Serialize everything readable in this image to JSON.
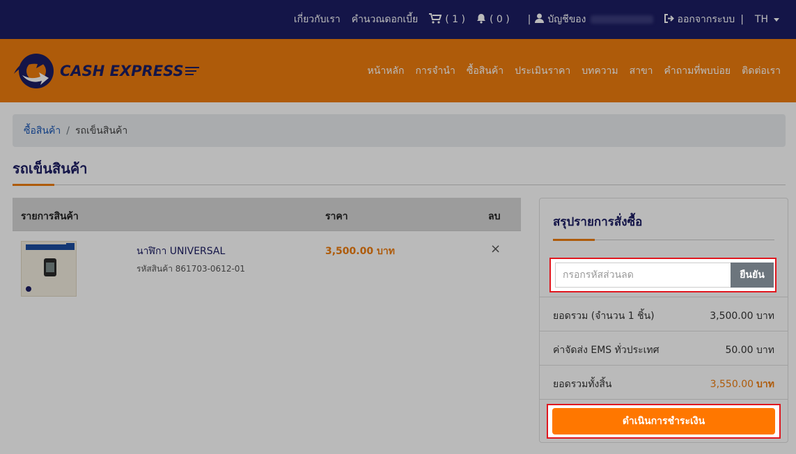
{
  "topbar": {
    "about": "เกี่ยวกับเรา",
    "interest_calc": "คำนวณดอกเบี้ย",
    "cart_count": "( 1 )",
    "notif_count": "( 0 )",
    "account_label": "บัญชีของ",
    "logout": "ออกจากระบบ",
    "sep": "|",
    "lang": "TH"
  },
  "brand": {
    "name": "CASH EXPRESS",
    "color_primary": "#1c1d63",
    "color_accent": "#ef7d0f"
  },
  "nav": [
    "หน้าหลัก",
    "การจำนำ",
    "ซื้อสินค้า",
    "ประเมินราคา",
    "บทความ",
    "สาขา",
    "คำถามที่พบบ่อย",
    "ติดต่อเรา"
  ],
  "breadcrumb": {
    "parent": "ซื้อสินค้า",
    "sep": "/",
    "current": "รถเข็นสินค้า"
  },
  "page_title": "รถเข็นสินค้า",
  "cart": {
    "headers": {
      "item": "รายการสินค้า",
      "price": "ราคา",
      "remove": "ลบ"
    },
    "items": [
      {
        "name": "นาฬิกา UNIVERSAL",
        "sku": "รหัสสินค้า 861703-0612-01",
        "price": "3,500.00 บาท",
        "remove_icon": "×"
      }
    ]
  },
  "summary": {
    "title": "สรุปรายการสั่งซื้อ",
    "coupon_placeholder": "กรอกรหัสส่วนลด",
    "coupon_button": "ยืนยัน",
    "subtotal_label": "ยอดรวม (จำนวน 1 ชิ้น)",
    "subtotal_value": "3,500.00 บาท",
    "shipping_label": "ค่าจัดส่ง EMS ทั่วประเทศ",
    "shipping_value": "50.00 บาท",
    "total_label": "ยอดรวมทั้งสิ้น",
    "total_value": "3,550.00",
    "total_currency": "บาท",
    "checkout_button": "ดำเนินการชำระเงิน"
  }
}
